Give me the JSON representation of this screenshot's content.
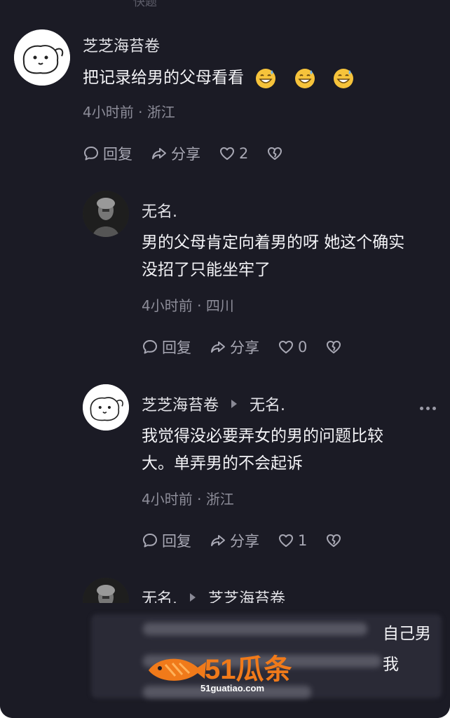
{
  "top_fragment": "快题",
  "comments": [
    {
      "author": "芝芝海苔卷",
      "content_lines": [
        "把记录给男的父母看看"
      ],
      "time": "4小时前",
      "location": "浙江",
      "reply_label": "回复",
      "share_label": "分享",
      "likes": "2"
    },
    {
      "author": "无名.",
      "content_lines": [
        "男的父母肯定向着男的呀 她这个确实",
        "没招了只能坐牢了"
      ],
      "time": "4小时前",
      "location": "四川",
      "reply_label": "回复",
      "share_label": "分享",
      "likes": "0"
    },
    {
      "author": "芝芝海苔卷",
      "reply_to": "无名.",
      "content_lines": [
        "我觉得没必要弄女的男的问题比较",
        "大。单弄男的不会起诉"
      ],
      "time": "4小时前",
      "location": "浙江",
      "reply_label": "回复",
      "share_label": "分享",
      "likes": "1"
    },
    {
      "author": "无名.",
      "reply_to": "芝芝海苔卷",
      "partial_text_1": "自己男",
      "partial_text_2": "我"
    }
  ],
  "watermark": {
    "brand": "51瓜条",
    "url": "51guatiao.com"
  },
  "colors": {
    "background": "#1b1b25",
    "text_primary": "#f3f3f6",
    "text_meta": "#8d8d99",
    "watermark_orange": "#f07a1a"
  }
}
